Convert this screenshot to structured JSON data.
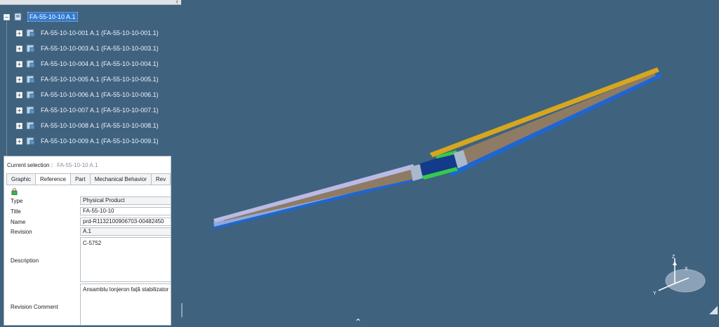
{
  "tree": {
    "root": {
      "expander": "−",
      "label": "FA-55-10-10 A.1"
    },
    "children": [
      {
        "expander": "+",
        "label": "FA-55-10-10-001 A.1 (FA-55-10-10-001.1)"
      },
      {
        "expander": "+",
        "label": "FA-55-10-10-003 A.1 (FA-55-10-10-003.1)"
      },
      {
        "expander": "+",
        "label": "FA-55-10-10-004 A.1 (FA-55-10-10-004.1)"
      },
      {
        "expander": "+",
        "label": "FA-55-10-10-005 A.1 (FA-55-10-10-005.1)"
      },
      {
        "expander": "+",
        "label": "FA-55-10-10-006 A.1 (FA-55-10-10-006.1)"
      },
      {
        "expander": "+",
        "label": "FA-55-10-10-007 A.1 (FA-55-10-10-007.1)"
      },
      {
        "expander": "+",
        "label": "FA-55-10-10-008 A.1 (FA-55-10-10-008.1)"
      },
      {
        "expander": "+",
        "label": "FA-55-10-10-009 A.1 (FA-55-10-10-009.1)"
      }
    ],
    "collapse_glyph": "‹"
  },
  "properties": {
    "current_selection_label": "Current selection :",
    "current_selection_value": "FA-55-10-10 A.1",
    "tabs": [
      "Graphic",
      "Reference",
      "Part",
      "Mechanical Behavior",
      "Rev"
    ],
    "active_tab": "Reference",
    "fields": {
      "type_label": "Type",
      "type_value": "Physical Product",
      "title_label": "Title",
      "title_value": "FA-55-10-10",
      "name_label": "Name",
      "name_value": "prd-R1132100906703-00482450",
      "revision_label": "Revision",
      "revision_value": "A.1",
      "description_label": "Description",
      "description_value": "C-5752",
      "revision_comment_label": "Revision Comment",
      "revision_comment_value": "Ansamblu lonjeron față stabilizator"
    }
  },
  "compass": {
    "axis_z": "Z",
    "axis_y": "Y",
    "axis_x": "X"
  },
  "viewport": {
    "background": "#3f627f",
    "bottom_glyph": "⌃"
  }
}
